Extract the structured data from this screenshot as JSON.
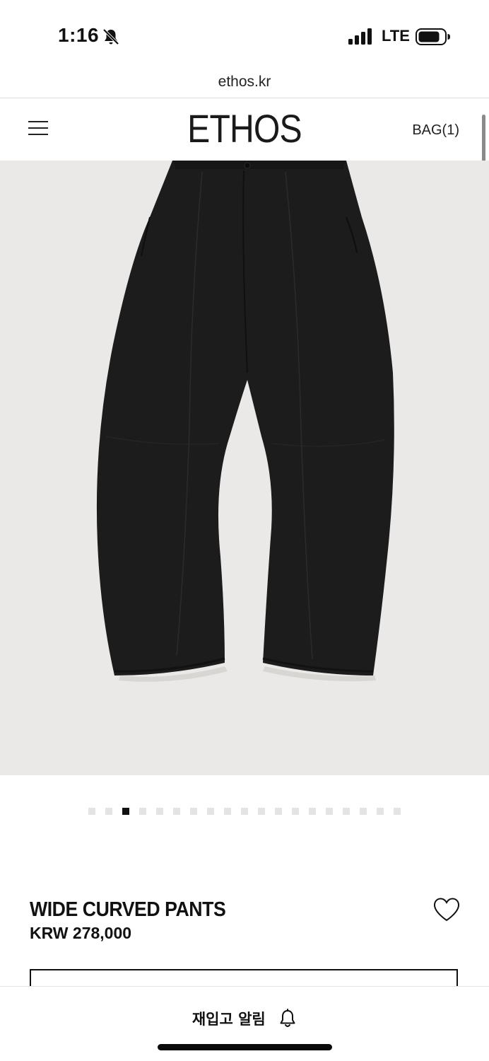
{
  "status_bar": {
    "time": "1:16",
    "network": "LTE",
    "icons": [
      "bell-slash-icon",
      "signal-icon",
      "battery-icon"
    ]
  },
  "browser": {
    "url": "ethos.kr"
  },
  "header": {
    "logo": "ETHOS",
    "bag_label": "BAG(1)",
    "menu_icon": "hamburger-menu-icon"
  },
  "gallery": {
    "image_subject": "black wide curved pants",
    "total_slides": 19,
    "active_slide": 3
  },
  "product": {
    "name": "WIDE CURVED PANTS",
    "price": "KRW 278,000",
    "wishlist_icon": "heart-icon"
  },
  "bottom_bar": {
    "restock_label": "재입고 알림",
    "restock_icon": "bell-icon"
  },
  "colors": {
    "image_background": "#ebe9e7",
    "product_color": "#1b1b1b",
    "active_dot": "#111111",
    "inactive_dot": "#e4e4e4"
  }
}
